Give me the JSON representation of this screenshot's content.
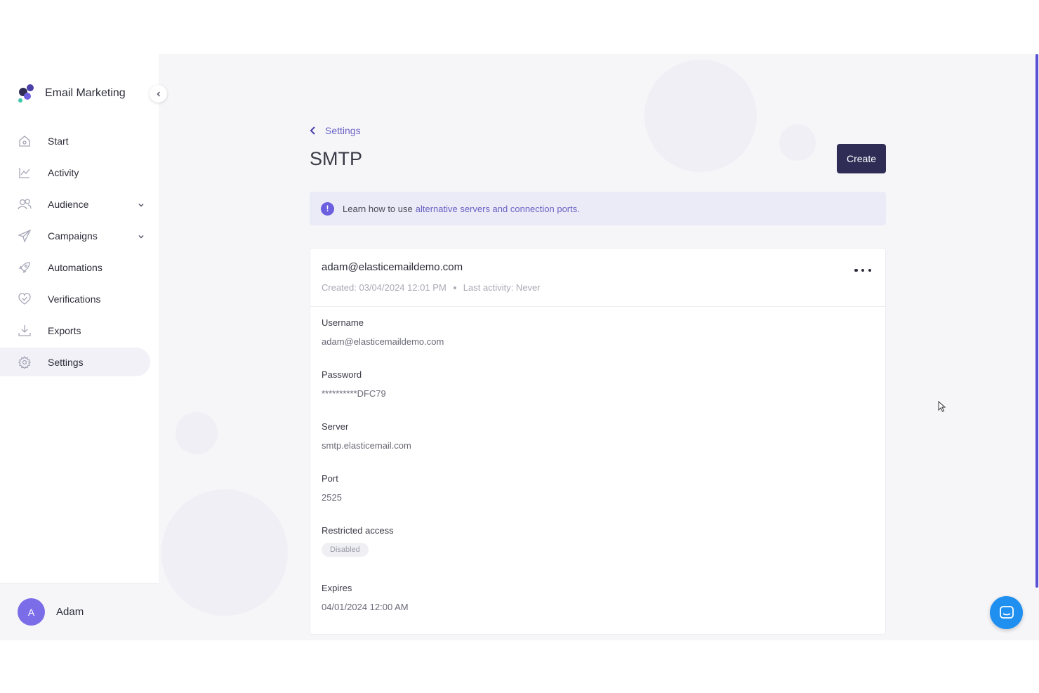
{
  "app": {
    "brand_title": "Email Marketing"
  },
  "sidebar": {
    "items": [
      {
        "label": "Start",
        "icon": "home-icon"
      },
      {
        "label": "Activity",
        "icon": "chart-icon"
      },
      {
        "label": "Audience",
        "icon": "users-icon"
      },
      {
        "label": "Campaigns",
        "icon": "send-icon"
      },
      {
        "label": "Automations",
        "icon": "rocket-icon"
      },
      {
        "label": "Verifications",
        "icon": "heart-check-icon"
      },
      {
        "label": "Exports",
        "icon": "download-icon"
      },
      {
        "label": "Settings",
        "icon": "gear-icon"
      }
    ],
    "active": "Settings",
    "user": {
      "initial": "A",
      "name": "Adam"
    }
  },
  "header": {
    "breadcrumb": "Settings",
    "title": "SMTP",
    "create_label": "Create"
  },
  "banner": {
    "text": "Learn how to use",
    "link": "alternative servers and connection ports."
  },
  "credential": {
    "email": "adam@elasticemaildemo.com",
    "created": "Created: 03/04/2024 12:01 PM",
    "last_activity": "Last activity: Never",
    "fields": {
      "username": {
        "label": "Username",
        "value": "adam@elasticemaildemo.com"
      },
      "password": {
        "label": "Password",
        "value": "**********DFC79"
      },
      "server": {
        "label": "Server",
        "value": "smtp.elasticemail.com"
      },
      "port": {
        "label": "Port",
        "value": "2525"
      },
      "restricted": {
        "label": "Restricted access",
        "value": "Disabled"
      },
      "expires": {
        "label": "Expires",
        "value": "04/01/2024 12:00 AM"
      }
    }
  },
  "colors": {
    "accent": "#6b63c4",
    "primary_button": "#2f2d55",
    "chat_button": "#1f8ff0",
    "avatar": "#7b6ce8"
  }
}
